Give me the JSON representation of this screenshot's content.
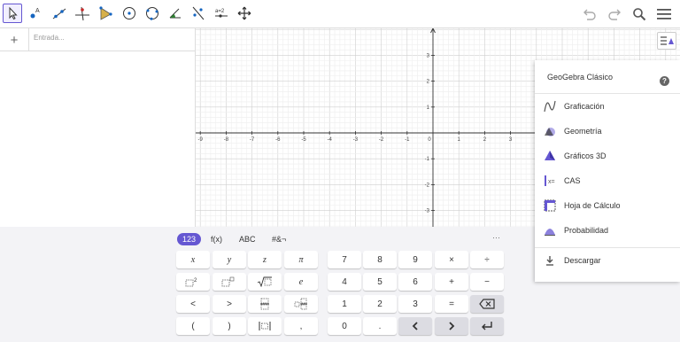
{
  "toolbar": {
    "tools": [
      "move-icon",
      "point-icon",
      "line-icon",
      "perpendicular-line-icon",
      "polygon-icon",
      "circle-center-point-icon",
      "circle-three-points-icon",
      "angle-icon",
      "reflect-line-icon",
      "slider-icon",
      "move-graphics-view-icon"
    ],
    "slider_label": "a=2",
    "right": [
      "undo-icon",
      "redo-icon",
      "search-icon",
      "menu-icon"
    ]
  },
  "algebra": {
    "plus": "+",
    "input_placeholder": "Entrada..."
  },
  "graphics": {
    "x_ticks": [
      "-9",
      "-8",
      "-7",
      "-6",
      "-5",
      "-4",
      "-3",
      "-2",
      "-1",
      "0",
      "1",
      "2",
      "3"
    ],
    "y_ticks": [
      "3",
      "2",
      "1",
      "-1",
      "-2",
      "-3"
    ]
  },
  "perspectives": {
    "title": "GeoGebra Clásico",
    "help": "?",
    "items": [
      "Graficación",
      "Geometría",
      "Gráficos 3D",
      "CAS",
      "Hoja de Cálculo",
      "Probabilidad"
    ],
    "download": "Descargar"
  },
  "keyboard": {
    "tabs": [
      "123",
      "f(x)",
      "ABC",
      "#&¬"
    ],
    "more": "···",
    "vars": [
      "x",
      "y",
      "z",
      "π"
    ],
    "row2_e": "e",
    "lt": "<",
    "gt": ">",
    "comma": ",",
    "lparen": "(",
    "rparen": ")",
    "digits": [
      "7",
      "8",
      "9",
      "4",
      "5",
      "6",
      "1",
      "2",
      "3",
      "0"
    ],
    "dot": ".",
    "ops": [
      "×",
      "÷",
      "+",
      "−",
      "="
    ]
  },
  "colors": {
    "accent": "#6557d2",
    "grid_minor": "#eeeeee",
    "grid_major": "#cfcfcf"
  }
}
